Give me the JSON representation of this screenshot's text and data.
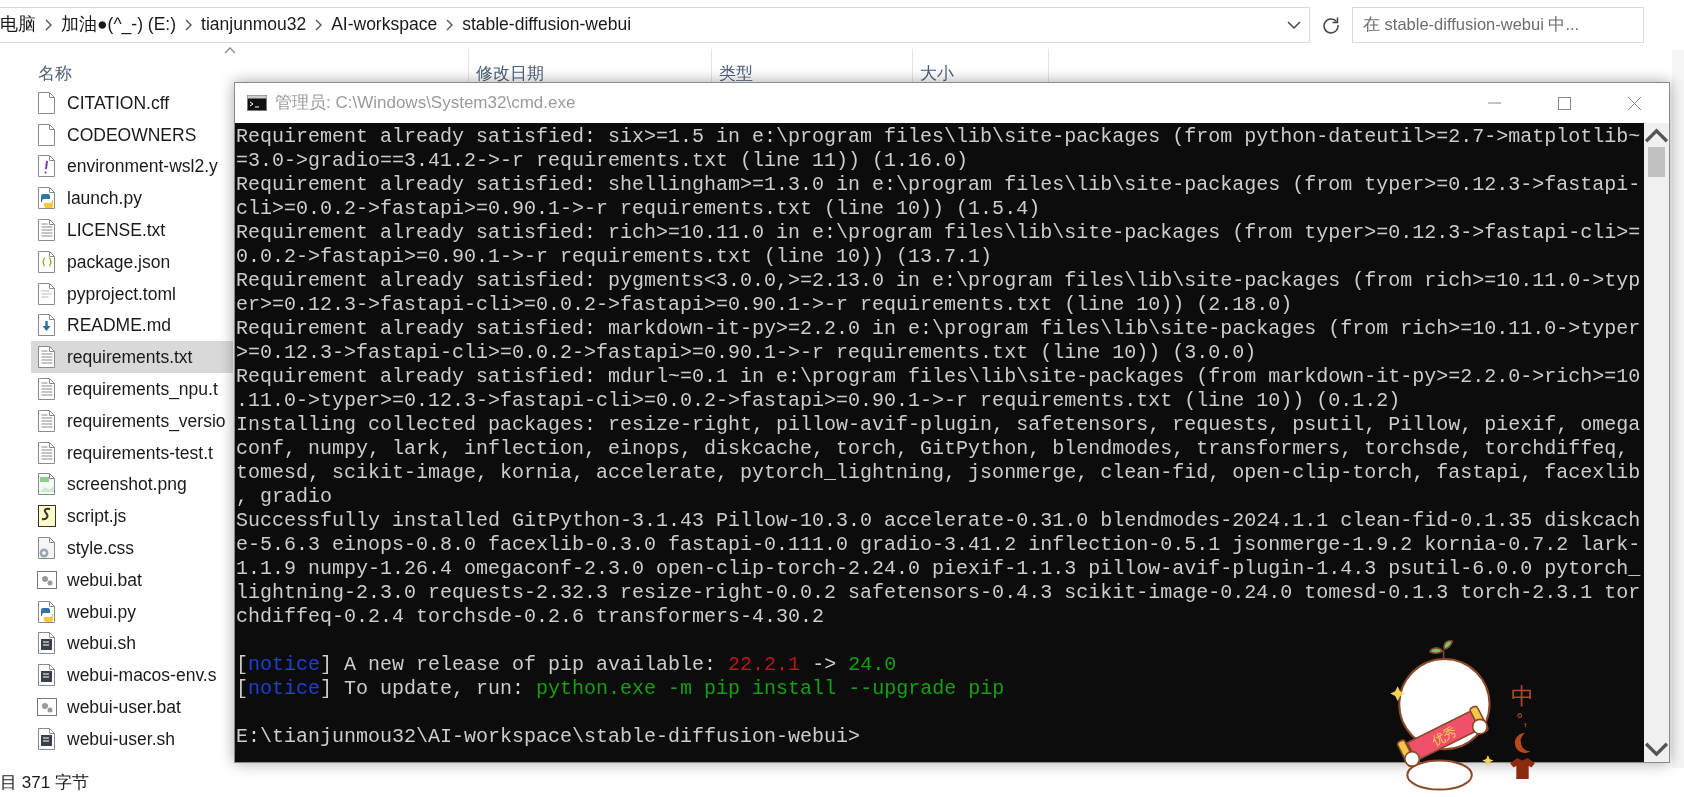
{
  "explorer": {
    "crumbs": [
      "电脑",
      "加油●(^_-) (E:)",
      "tianjunmou32",
      "AI-workspace",
      "stable-diffusion-webui"
    ],
    "search": {
      "placeholder": "在 stable-diffusion-webui 中..."
    },
    "columns": [
      {
        "label": "名称",
        "sorted": true
      },
      {
        "label": "修改日期",
        "sorted": false
      },
      {
        "label": "类型",
        "sorted": false
      },
      {
        "label": "大小",
        "sorted": false
      }
    ],
    "files": [
      {
        "name": "CITATION.cff",
        "kind": "blank",
        "selected": false
      },
      {
        "name": "CODEOWNERS",
        "kind": "blank",
        "selected": false
      },
      {
        "name": "environment-wsl2.y",
        "kind": "yaml",
        "selected": false
      },
      {
        "name": "launch.py",
        "kind": "python",
        "selected": false
      },
      {
        "name": "LICENSE.txt",
        "kind": "text",
        "selected": false
      },
      {
        "name": "package.json",
        "kind": "json",
        "selected": false
      },
      {
        "name": "pyproject.toml",
        "kind": "toml",
        "selected": false
      },
      {
        "name": "README.md",
        "kind": "markdown",
        "selected": false
      },
      {
        "name": "requirements.txt",
        "kind": "text",
        "selected": true
      },
      {
        "name": "requirements_npu.t",
        "kind": "text",
        "selected": false
      },
      {
        "name": "requirements_versio",
        "kind": "text",
        "selected": false
      },
      {
        "name": "requirements-test.t",
        "kind": "text",
        "selected": false
      },
      {
        "name": "screenshot.png",
        "kind": "image",
        "selected": false
      },
      {
        "name": "script.js",
        "kind": "script",
        "selected": false
      },
      {
        "name": "style.css",
        "kind": "css",
        "selected": false
      },
      {
        "name": "webui.bat",
        "kind": "batch",
        "selected": false
      },
      {
        "name": "webui.py",
        "kind": "python",
        "selected": false
      },
      {
        "name": "webui.sh",
        "kind": "shell",
        "selected": false
      },
      {
        "name": "webui-macos-env.s",
        "kind": "shell",
        "selected": false
      },
      {
        "name": "webui-user.bat",
        "kind": "batch",
        "selected": false
      },
      {
        "name": "webui-user.sh",
        "kind": "shell",
        "selected": false
      }
    ],
    "status_bar": "目 371 字节"
  },
  "console_window": {
    "title": "管理员: C:\\Windows\\System32\\cmd.exe",
    "lines": [
      {
        "kind": "text",
        "segments": [
          {
            "text": "Requirement already satisfied: six>=1.5 in e:\\program files\\lib\\site-packages (from python-dateutil>=2.7->matplotlib~",
            "color": "#cccccc"
          }
        ]
      },
      {
        "kind": "text",
        "segments": [
          {
            "text": "=3.0->gradio==3.41.2->-r requirements.txt (line 11)) (1.16.0)",
            "color": "#cccccc"
          }
        ]
      },
      {
        "kind": "text",
        "segments": [
          {
            "text": "Requirement already satisfied: shellingham>=1.3.0 in e:\\program files\\lib\\site-packages (from typer>=0.12.3->fastapi-",
            "color": "#cccccc"
          }
        ]
      },
      {
        "kind": "text",
        "segments": [
          {
            "text": "cli>=0.0.2->fastapi>=0.90.1->-r requirements.txt (line 10)) (1.5.4)",
            "color": "#cccccc"
          }
        ]
      },
      {
        "kind": "text",
        "segments": [
          {
            "text": "Requirement already satisfied: rich>=10.11.0 in e:\\program files\\lib\\site-packages (from typer>=0.12.3->fastapi-cli>=",
            "color": "#cccccc"
          }
        ]
      },
      {
        "kind": "text",
        "segments": [
          {
            "text": "0.0.2->fastapi>=0.90.1->-r requirements.txt (line 10)) (13.7.1)",
            "color": "#cccccc"
          }
        ]
      },
      {
        "kind": "text",
        "segments": [
          {
            "text": "Requirement already satisfied: pygments<3.0.0,>=2.13.0 in e:\\program files\\lib\\site-packages (from rich>=10.11.0->typ",
            "color": "#cccccc"
          }
        ]
      },
      {
        "kind": "text",
        "segments": [
          {
            "text": "er>=0.12.3->fastapi-cli>=0.0.2->fastapi>=0.90.1->-r requirements.txt (line 10)) (2.18.0)",
            "color": "#cccccc"
          }
        ]
      },
      {
        "kind": "text",
        "segments": [
          {
            "text": "Requirement already satisfied: markdown-it-py>=2.2.0 in e:\\program files\\lib\\site-packages (from rich>=10.11.0->typer",
            "color": "#cccccc"
          }
        ]
      },
      {
        "kind": "text",
        "segments": [
          {
            "text": ">=0.12.3->fastapi-cli>=0.0.2->fastapi>=0.90.1->-r requirements.txt (line 10)) (3.0.0)",
            "color": "#cccccc"
          }
        ]
      },
      {
        "kind": "text",
        "segments": [
          {
            "text": "Requirement already satisfied: mdurl~=0.1 in e:\\program files\\lib\\site-packages (from markdown-it-py>=2.2.0->rich>=10",
            "color": "#cccccc"
          }
        ]
      },
      {
        "kind": "text",
        "segments": [
          {
            "text": ".11.0->typer>=0.12.3->fastapi-cli>=0.0.2->fastapi>=0.90.1->-r requirements.txt (line 10)) (0.1.2)",
            "color": "#cccccc"
          }
        ]
      },
      {
        "kind": "text",
        "segments": [
          {
            "text": "Installing collected packages: resize-right, pillow-avif-plugin, safetensors, requests, psutil, Pillow, piexif, omega",
            "color": "#cccccc"
          }
        ]
      },
      {
        "kind": "text",
        "segments": [
          {
            "text": "conf, numpy, lark, inflection, einops, diskcache, torch, GitPython, blendmodes, transformers, torchsde, torchdiffeq,",
            "color": "#cccccc"
          }
        ]
      },
      {
        "kind": "text",
        "segments": [
          {
            "text": "tomesd, scikit-image, kornia, accelerate, pytorch_lightning, jsonmerge, clean-fid, open-clip-torch, fastapi, facexlib",
            "color": "#cccccc"
          }
        ]
      },
      {
        "kind": "text",
        "segments": [
          {
            "text": ", gradio",
            "color": "#cccccc"
          }
        ]
      },
      {
        "kind": "text",
        "segments": [
          {
            "text": "Successfully installed GitPython-3.1.43 Pillow-10.3.0 accelerate-0.31.0 blendmodes-2024.1.1 clean-fid-0.1.35 diskcach",
            "color": "#cccccc"
          }
        ]
      },
      {
        "kind": "text",
        "segments": [
          {
            "text": "e-5.6.3 einops-0.8.0 facexlib-0.3.0 fastapi-0.111.0 gradio-3.41.2 inflection-0.5.1 jsonmerge-1.9.2 kornia-0.7.2 lark-",
            "color": "#cccccc"
          }
        ]
      },
      {
        "kind": "text",
        "segments": [
          {
            "text": "1.1.9 numpy-1.26.4 omegaconf-2.3.0 open-clip-torch-2.24.0 piexif-1.1.3 pillow-avif-plugin-1.4.3 psutil-6.0.0 pytorch_",
            "color": "#cccccc"
          }
        ]
      },
      {
        "kind": "text",
        "segments": [
          {
            "text": "lightning-2.3.0 requests-2.32.3 resize-right-0.0.2 safetensors-0.4.3 scikit-image-0.24.0 tomesd-0.1.3 torch-2.3.1 tor",
            "color": "#cccccc"
          }
        ]
      },
      {
        "kind": "text",
        "segments": [
          {
            "text": "chdiffeq-0.2.4 torchsde-0.2.6 transformers-4.30.2",
            "color": "#cccccc"
          }
        ]
      },
      {
        "kind": "blank"
      },
      {
        "kind": "text",
        "segments": [
          {
            "text": "[",
            "color": "#cccccc"
          },
          {
            "text": "notice",
            "color": "#1f3fd6"
          },
          {
            "text": "] A new release of pip available: ",
            "color": "#cccccc"
          },
          {
            "text": "22.2.1",
            "color": "#c50f1f"
          },
          {
            "text": " -> ",
            "color": "#cccccc"
          },
          {
            "text": "24.0",
            "color": "#13a10e"
          }
        ]
      },
      {
        "kind": "text",
        "segments": [
          {
            "text": "[",
            "color": "#cccccc"
          },
          {
            "text": "notice",
            "color": "#1f3fd6"
          },
          {
            "text": "] To update, run: ",
            "color": "#cccccc"
          },
          {
            "text": "python.exe -m pip install --upgrade pip",
            "color": "#13a10e"
          }
        ]
      },
      {
        "kind": "blank"
      },
      {
        "kind": "text",
        "segments": [
          {
            "text": "E:\\tianjunmou32\\AI-workspace\\stable-diffusion-webui>",
            "color": "#cccccc"
          }
        ]
      }
    ]
  },
  "ime_toolbar": {
    "mode": "中",
    "punctuation": "°,",
    "banner": "优秀"
  }
}
